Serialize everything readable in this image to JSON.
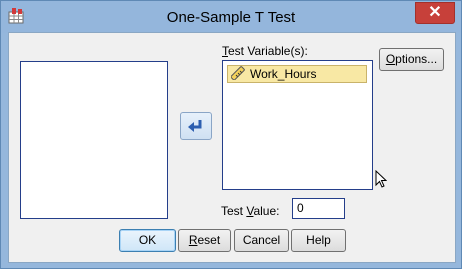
{
  "window": {
    "title": "One-Sample T Test",
    "close_glyph": "✕"
  },
  "icons": {
    "app": "spss-dialog-icon",
    "var": "scale-variable-icon",
    "move": "move-right-arrow-icon"
  },
  "test_variables": {
    "label_hotkey": "T",
    "label_rest": "est Variable(s):",
    "items": [
      {
        "name": "Work_Hours"
      }
    ]
  },
  "test_value": {
    "label_prefix": "Test ",
    "label_hotkey": "V",
    "label_rest": "alue:",
    "value": "0"
  },
  "buttons": {
    "options": {
      "hotkey": "O",
      "rest": "ptions..."
    },
    "ok": "OK",
    "reset": {
      "hotkey": "R",
      "rest": "eset"
    },
    "cancel": "Cancel",
    "help": "Help"
  },
  "colors": {
    "title_bar": "#94b6dc",
    "close": "#c7403a",
    "selected_item": "#f8e8a4",
    "client": "#f0f0f0"
  }
}
